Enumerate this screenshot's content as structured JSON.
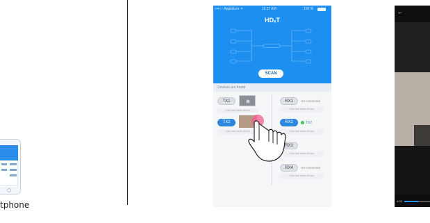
{
  "left_panel": {
    "caption": "tphone"
  },
  "phone": {
    "status": {
      "carrier": "•••○○ Applidium ᯤ",
      "time": "11:27 AM",
      "battery": "100 %"
    },
    "app_title": "HDₓT",
    "scan_label": "SCAN",
    "found_label": "Devices are found",
    "hint_text": "Click and name device",
    "tx": [
      {
        "label": "TX1",
        "active": false
      },
      {
        "label": "TX2",
        "active": true
      }
    ],
    "rx": [
      {
        "label": "RX1",
        "state": "Un-connected",
        "active": false
      },
      {
        "label": "RX2",
        "state": "TX2",
        "active": true
      },
      {
        "label": "RX3",
        "active": false
      },
      {
        "label": "RX4",
        "state": "Un-connected",
        "active": false
      }
    ]
  },
  "video": {
    "time": "4:33",
    "progress": 0.55
  },
  "colors": {
    "accent": "#1d8ff0",
    "connected": "#3fc65a"
  }
}
